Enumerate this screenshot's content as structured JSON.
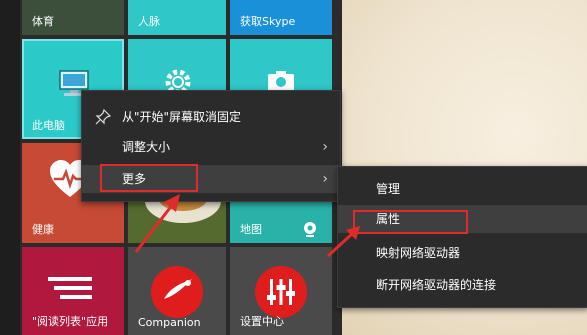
{
  "tiles": {
    "sports": "体育",
    "contacts": "人脉",
    "skype": "获取Skype",
    "this_pc": "此电脑",
    "health": "健康",
    "maps": "地图",
    "reading_list": "\"阅读列表\"应用",
    "companion": "Companion",
    "settings": "设置中心"
  },
  "context_menu": {
    "unpin": "从\"开始\"屏幕取消固定",
    "resize": "调整大小",
    "more": "更多"
  },
  "submenu": {
    "manage": "管理",
    "properties": "属性",
    "map_drive": "映射网络驱动器",
    "disconnect_drive": "断开网络驱动器的连接"
  },
  "colors": {
    "highlight_box": "#e02b2b",
    "teal_tile": "#2fc7c7",
    "health_tile": "#c74a34",
    "reading_tile": "#b0183d"
  }
}
